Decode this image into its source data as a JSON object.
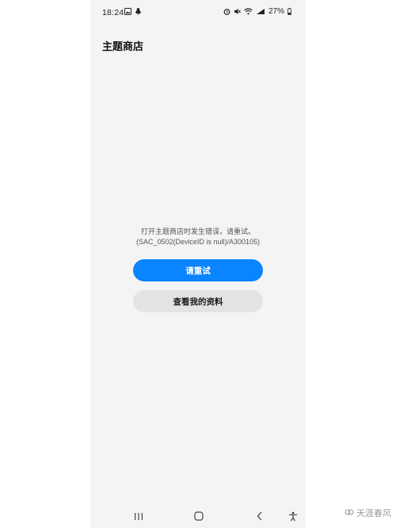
{
  "status_bar": {
    "time": "18:24",
    "battery": "27%"
  },
  "header": {
    "title": "主题商店"
  },
  "error": {
    "message": "打开主题商店时发生错误，请重试。",
    "code": "(SAC_0502(DeviceID is null)/A300105)"
  },
  "buttons": {
    "retry_label": "请重试",
    "view_profile_label": "查看我的资料"
  },
  "watermark": {
    "text": "天涯春风"
  },
  "colors": {
    "accent": "#0a84ff",
    "background": "#f4f4f4",
    "secondary_button": "#e3e3e3"
  },
  "icons": {
    "status_left": [
      "gallery-icon",
      "notification-icon"
    ],
    "status_right": [
      "alarm-icon",
      "mute-icon",
      "wifi-icon",
      "signal-icon",
      "battery-icon"
    ],
    "nav": [
      "recent-apps-icon",
      "home-icon",
      "back-icon",
      "accessibility-icon"
    ]
  }
}
